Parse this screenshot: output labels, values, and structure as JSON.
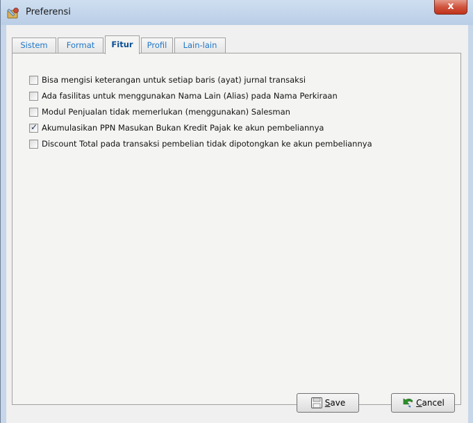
{
  "window": {
    "title": "Preferensi",
    "close_label": "x"
  },
  "tabs": [
    {
      "label": "Sistem",
      "active": false
    },
    {
      "label": "Format",
      "active": false
    },
    {
      "label": "Fitur",
      "active": true
    },
    {
      "label": "Profil",
      "active": false
    },
    {
      "label": "Lain-lain",
      "active": false
    }
  ],
  "options": [
    {
      "label": "Bisa mengisi keterangan untuk setiap baris (ayat) jurnal transaksi",
      "checked": false
    },
    {
      "label": "Ada fasilitas untuk menggunakan Nama Lain (Alias) pada Nama Perkiraan",
      "checked": false
    },
    {
      "label": "Modul Penjualan tidak memerlukan (menggunakan) Salesman",
      "checked": false
    },
    {
      "label": "Akumulasikan PPN Masukan Bukan Kredit Pajak ke akun pembeliannya",
      "checked": true
    },
    {
      "label": "Discount Total pada transaksi pembelian tidak dipotongkan ke akun pembeliannya",
      "checked": false
    }
  ],
  "buttons": {
    "save_mnemonic": "S",
    "save_rest": "ave",
    "cancel_mnemonic": "C",
    "cancel_rest": "ancel"
  },
  "icons": {
    "app": "preferences-app-icon",
    "save": "floppy-disk-icon",
    "cancel": "undo-arrow-icon"
  }
}
